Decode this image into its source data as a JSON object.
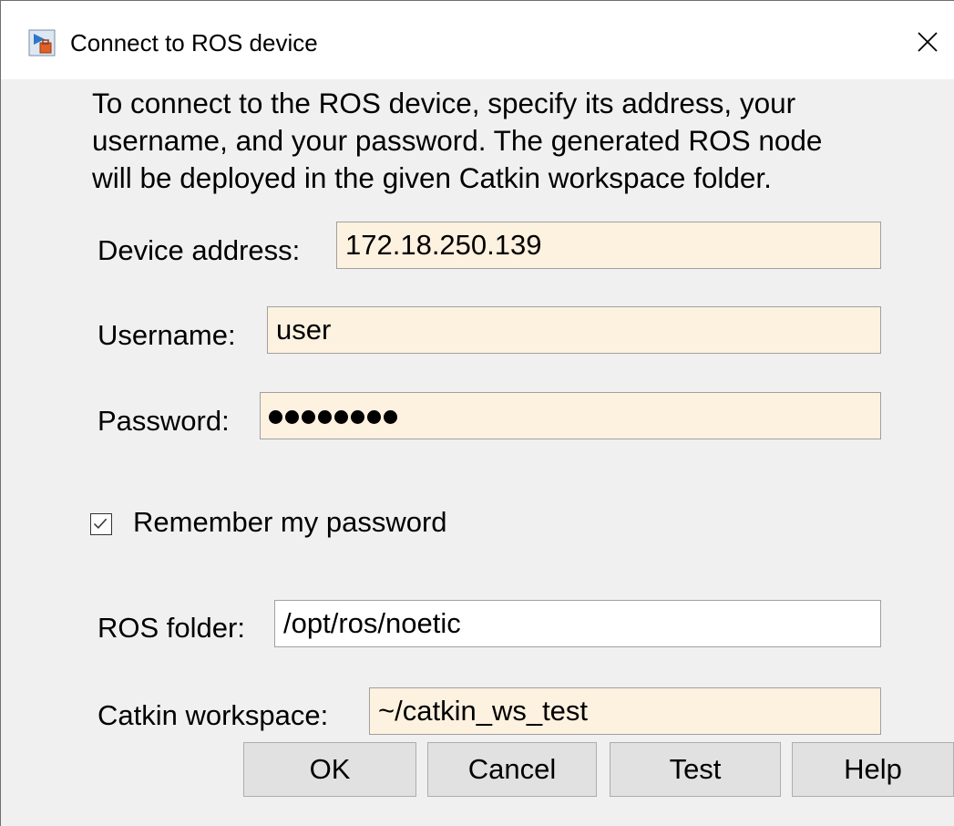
{
  "window": {
    "title": "Connect to ROS device"
  },
  "intro": {
    "line1": "To connect to the ROS device, specify its address, your",
    "line2": "username, and your password. The generated ROS node",
    "line3": "will be deployed in the given Catkin workspace folder."
  },
  "form": {
    "device_address": {
      "label": "Device address:",
      "value": "172.18.250.139"
    },
    "username": {
      "label": "Username:",
      "value": "user"
    },
    "password": {
      "label": "Password:",
      "masked_length": 8
    },
    "remember": {
      "label": "Remember my password",
      "checked": true
    },
    "ros_folder": {
      "label": "ROS folder:",
      "value": "/opt/ros/noetic"
    },
    "catkin_workspace": {
      "label": "Catkin workspace:",
      "value": "~/catkin_ws_test"
    }
  },
  "buttons": {
    "ok": "OK",
    "cancel": "Cancel",
    "test": "Test",
    "help": "Help"
  },
  "icons": {
    "app": "matlab-app-icon",
    "close": "close-icon",
    "check": "checkmark-icon"
  },
  "colors": {
    "field_highlight": "#fdf1e0",
    "field_plain": "#ffffff",
    "dialog_bg": "#f0f0f0",
    "button_bg": "#e1e1e1"
  }
}
